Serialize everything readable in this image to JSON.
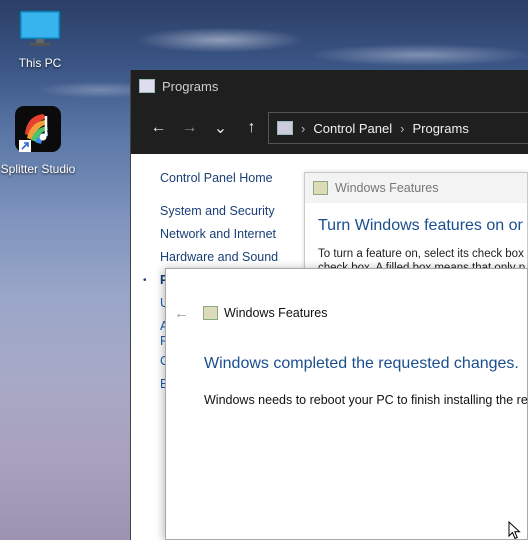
{
  "desktop": {
    "icons": [
      {
        "label": "This PC",
        "icon": "monitor-icon"
      },
      {
        "label": "Splitter Studio",
        "icon": "splitter-studio-app-icon"
      }
    ]
  },
  "control_panel": {
    "window_title": "Programs",
    "nav": {
      "back": "←",
      "forward": "→",
      "recent": "⌄",
      "up": "↑"
    },
    "breadcrumb": [
      "Control Panel",
      "Programs"
    ],
    "breadcrumb_separator": "›",
    "sidebar": [
      "Control Panel Home",
      "System and Security",
      "Network and Internet",
      "Hardware and Sound"
    ],
    "sidebar_fragments": [
      "P",
      "U",
      "A",
      "P",
      "C",
      "E"
    ],
    "bullet": "•"
  },
  "windows_features_back": {
    "title": "Windows Features",
    "heading": "Turn Windows features on or o",
    "body_line1": "To turn a feature on, select its check box",
    "body_line2": "check box. A filled box means that only p"
  },
  "dialog": {
    "back": "←",
    "title": "Windows Features",
    "heading": "Windows completed the requested changes.",
    "body": "Windows needs to reboot your PC to finish installing the requ"
  },
  "colors": {
    "link": "#1a3f78",
    "heading": "#1a4f8e",
    "titlebar": "#1f1f1f"
  }
}
